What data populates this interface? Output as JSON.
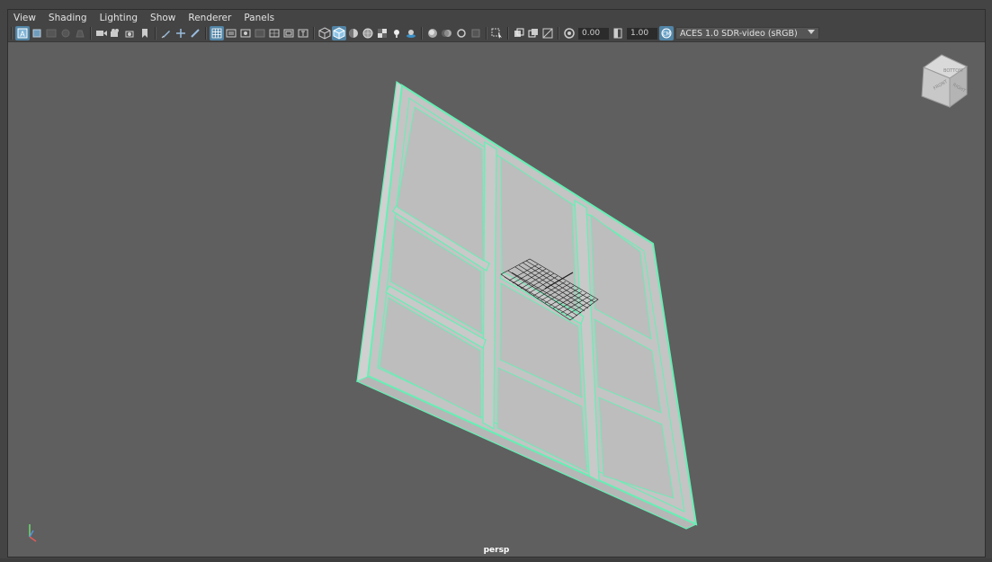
{
  "menu": {
    "items": [
      "View",
      "Shading",
      "Lighting",
      "Show",
      "Renderer",
      "Panels"
    ]
  },
  "toolbar": {
    "exposure_value": "0.00",
    "gamma_value": "1.00",
    "color_management_label": "ACES 1.0 SDR-video (sRGB)",
    "icons": [
      "select-camera-icon",
      "camera-attributes-icon",
      "bookmark-icon",
      "image-plane-icon",
      "grid-icon",
      "film-gate-icon",
      "resolution-gate-icon",
      "gate-mask-icon",
      "field-chart-icon",
      "safe-action-icon",
      "safe-title-icon",
      "wireframe-icon",
      "smooth-shade-icon",
      "default-material-icon",
      "wireframe-on-shaded-icon",
      "textured-icon",
      "lights-icon",
      "shadows-icon",
      "ambient-occlusion-icon",
      "motion-blur-icon",
      "anti-aliasing-icon",
      "depth-of-field-icon",
      "isolate-select-icon",
      "xray-icon",
      "xray-joints-icon",
      "backface-culling-icon"
    ]
  },
  "viewport": {
    "camera_name": "persp",
    "view_cube_faces": [
      "FRONT",
      "RIGHT",
      "BOTTOM"
    ],
    "selection_color": "#64f0b4",
    "mesh_color": "#c4c4c4"
  }
}
